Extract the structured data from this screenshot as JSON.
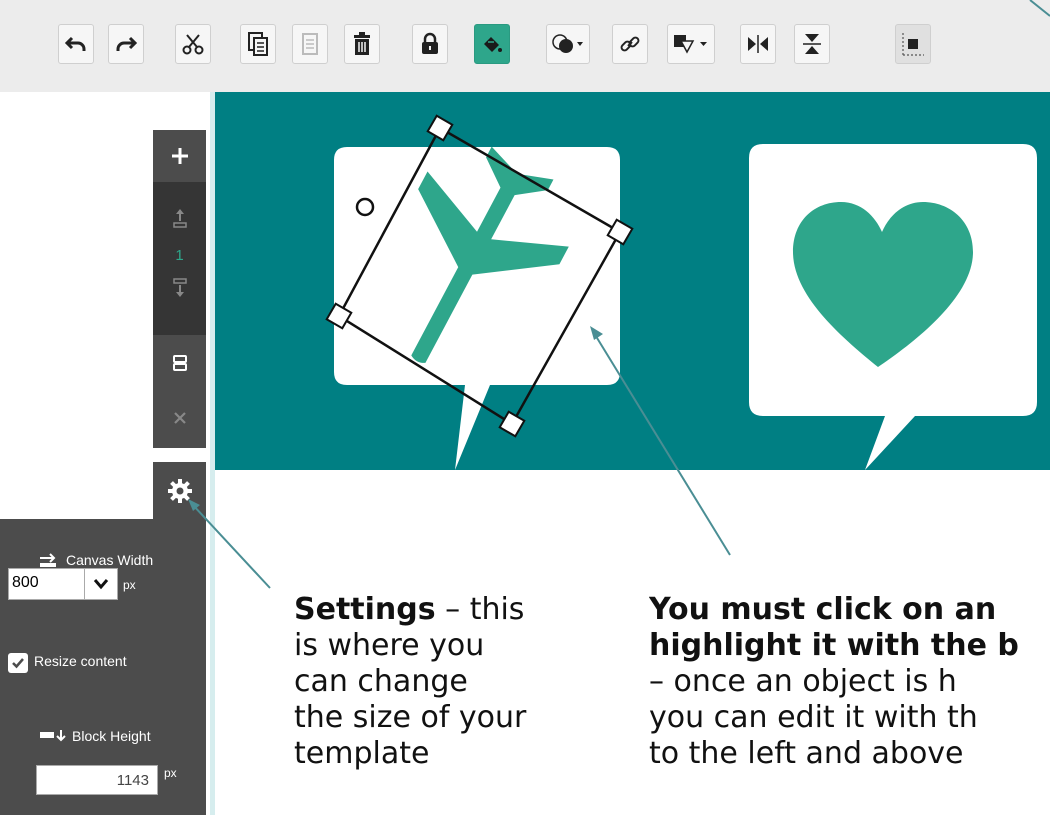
{
  "toolbar": {
    "buttons": [
      {
        "name": "undo-button",
        "icon": "undo-icon"
      },
      {
        "name": "redo-button",
        "icon": "redo-icon"
      },
      {
        "name": "cut-button",
        "icon": "scissors-icon"
      },
      {
        "name": "copy-button",
        "icon": "copy-icon"
      },
      {
        "name": "paste-button",
        "icon": "paste-icon"
      },
      {
        "name": "delete-button",
        "icon": "trash-icon"
      },
      {
        "name": "lock-button",
        "icon": "lock-icon"
      },
      {
        "name": "fill-color-button",
        "icon": "paint-bucket-icon",
        "active": true
      },
      {
        "name": "shape-button",
        "icon": "shape-overlap-icon"
      },
      {
        "name": "link-button",
        "icon": "link-icon"
      },
      {
        "name": "arrange-button",
        "icon": "layers-icon"
      },
      {
        "name": "flip-horizontal-button",
        "icon": "flip-horizontal-icon"
      },
      {
        "name": "flip-vertical-button",
        "icon": "flip-vertical-icon"
      },
      {
        "name": "align-button",
        "icon": "align-icon"
      }
    ]
  },
  "sidebar": {
    "page_number": "1",
    "icons": [
      "plus-icon",
      "move-up-icon",
      "move-down-icon",
      "duplicate-icon",
      "close-icon",
      "gear-icon"
    ]
  },
  "settings": {
    "canvas_width_label": "Canvas Width",
    "canvas_width_value": "800",
    "canvas_width_unit": "px",
    "resize_content_label": "Resize content",
    "resize_content_checked": true,
    "block_height_label": "Block Height",
    "block_height_value": "1143",
    "block_height_unit": "px"
  },
  "annotations": {
    "settings": {
      "title": "Settings",
      "lines": [
        "– this",
        "is where you",
        "can change",
        "the size of your",
        "template"
      ]
    },
    "object": {
      "title_lines": [
        "You must click on an",
        "highlight it with the b"
      ],
      "lines": [
        "– once an object is h",
        "you can edit it with th",
        "to the left and above"
      ]
    }
  },
  "colors": {
    "accent": "#2ea68b",
    "canvas_bg": "#007f83",
    "sidebar_bg": "#4c4c4c",
    "sidebar_dark": "#353535",
    "toolbar_bg": "#ececec",
    "callout_line": "#4a8e94"
  }
}
